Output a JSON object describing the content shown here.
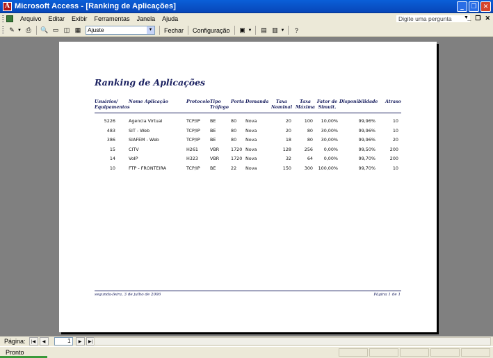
{
  "window": {
    "title": "Microsoft Access - [Ranking de Aplicações]",
    "app_icon": "access-icon"
  },
  "menu": {
    "items": [
      "Arquivo",
      "Editar",
      "Exibir",
      "Ferramentas",
      "Janela",
      "Ajuda"
    ],
    "help_placeholder": "Digite uma pergunta"
  },
  "toolbar": {
    "zoom_value": "Ajuste",
    "close_label": "Fechar",
    "setup_label": "Configuração"
  },
  "report": {
    "title": "Ranking de Aplicações",
    "headers": {
      "users": "Usuários/",
      "users2": "Equipamentos",
      "app": "Nome Aplicação",
      "protocol": "Protocolo",
      "traffic": "Tipo",
      "traffic2": "Tráfego",
      "port": "Porta",
      "demand": "Demanda",
      "nominal": "Taxa",
      "nominal2": "Nominal",
      "max": "Taxa",
      "max2": "Máxima",
      "factor": "Fator de",
      "factor2": "Simult.",
      "avail": "Disponibilidade",
      "delay": "Atraso"
    },
    "rows": [
      {
        "users": "5226",
        "app": "Agencia Virtual",
        "protocol": "TCP/IP",
        "traffic": "BE",
        "port": "80",
        "demand": "Nova",
        "nominal": "20",
        "max": "100",
        "factor": "10,00%",
        "avail": "99,96%",
        "delay": "10"
      },
      {
        "users": "483",
        "app": "SIT - Web",
        "protocol": "TCP/IP",
        "traffic": "BE",
        "port": "80",
        "demand": "Nova",
        "nominal": "20",
        "max": "80",
        "factor": "30,00%",
        "avail": "99,96%",
        "delay": "10"
      },
      {
        "users": "386",
        "app": "SIAFEM - Web",
        "protocol": "TCP/IP",
        "traffic": "BE",
        "port": "80",
        "demand": "Nova",
        "nominal": "18",
        "max": "80",
        "factor": "30,00%",
        "avail": "99,96%",
        "delay": "20"
      },
      {
        "users": "15",
        "app": "CITV",
        "protocol": "H261",
        "traffic": "VBR",
        "port": "1720",
        "demand": "Nova",
        "nominal": "128",
        "max": "256",
        "factor": "0,00%",
        "avail": "99,50%",
        "delay": "200"
      },
      {
        "users": "14",
        "app": "VoIP",
        "protocol": "H323",
        "traffic": "VBR",
        "port": "1720",
        "demand": "Nova",
        "nominal": "32",
        "max": "64",
        "factor": "0,00%",
        "avail": "99,70%",
        "delay": "200"
      },
      {
        "users": "10",
        "app": "FTP - FRONTEIRA",
        "protocol": "TCP/IP",
        "traffic": "BE",
        "port": "22",
        "demand": "Nova",
        "nominal": "150",
        "max": "300",
        "factor": "100,00%",
        "avail": "99,70%",
        "delay": "10"
      }
    ],
    "footer_date": "segunda-feira, 3 de julho de 2006",
    "footer_page": "Página 1 de 1"
  },
  "navigation": {
    "label": "Página:",
    "page_value": "1"
  },
  "status": {
    "text": "Pronto"
  }
}
